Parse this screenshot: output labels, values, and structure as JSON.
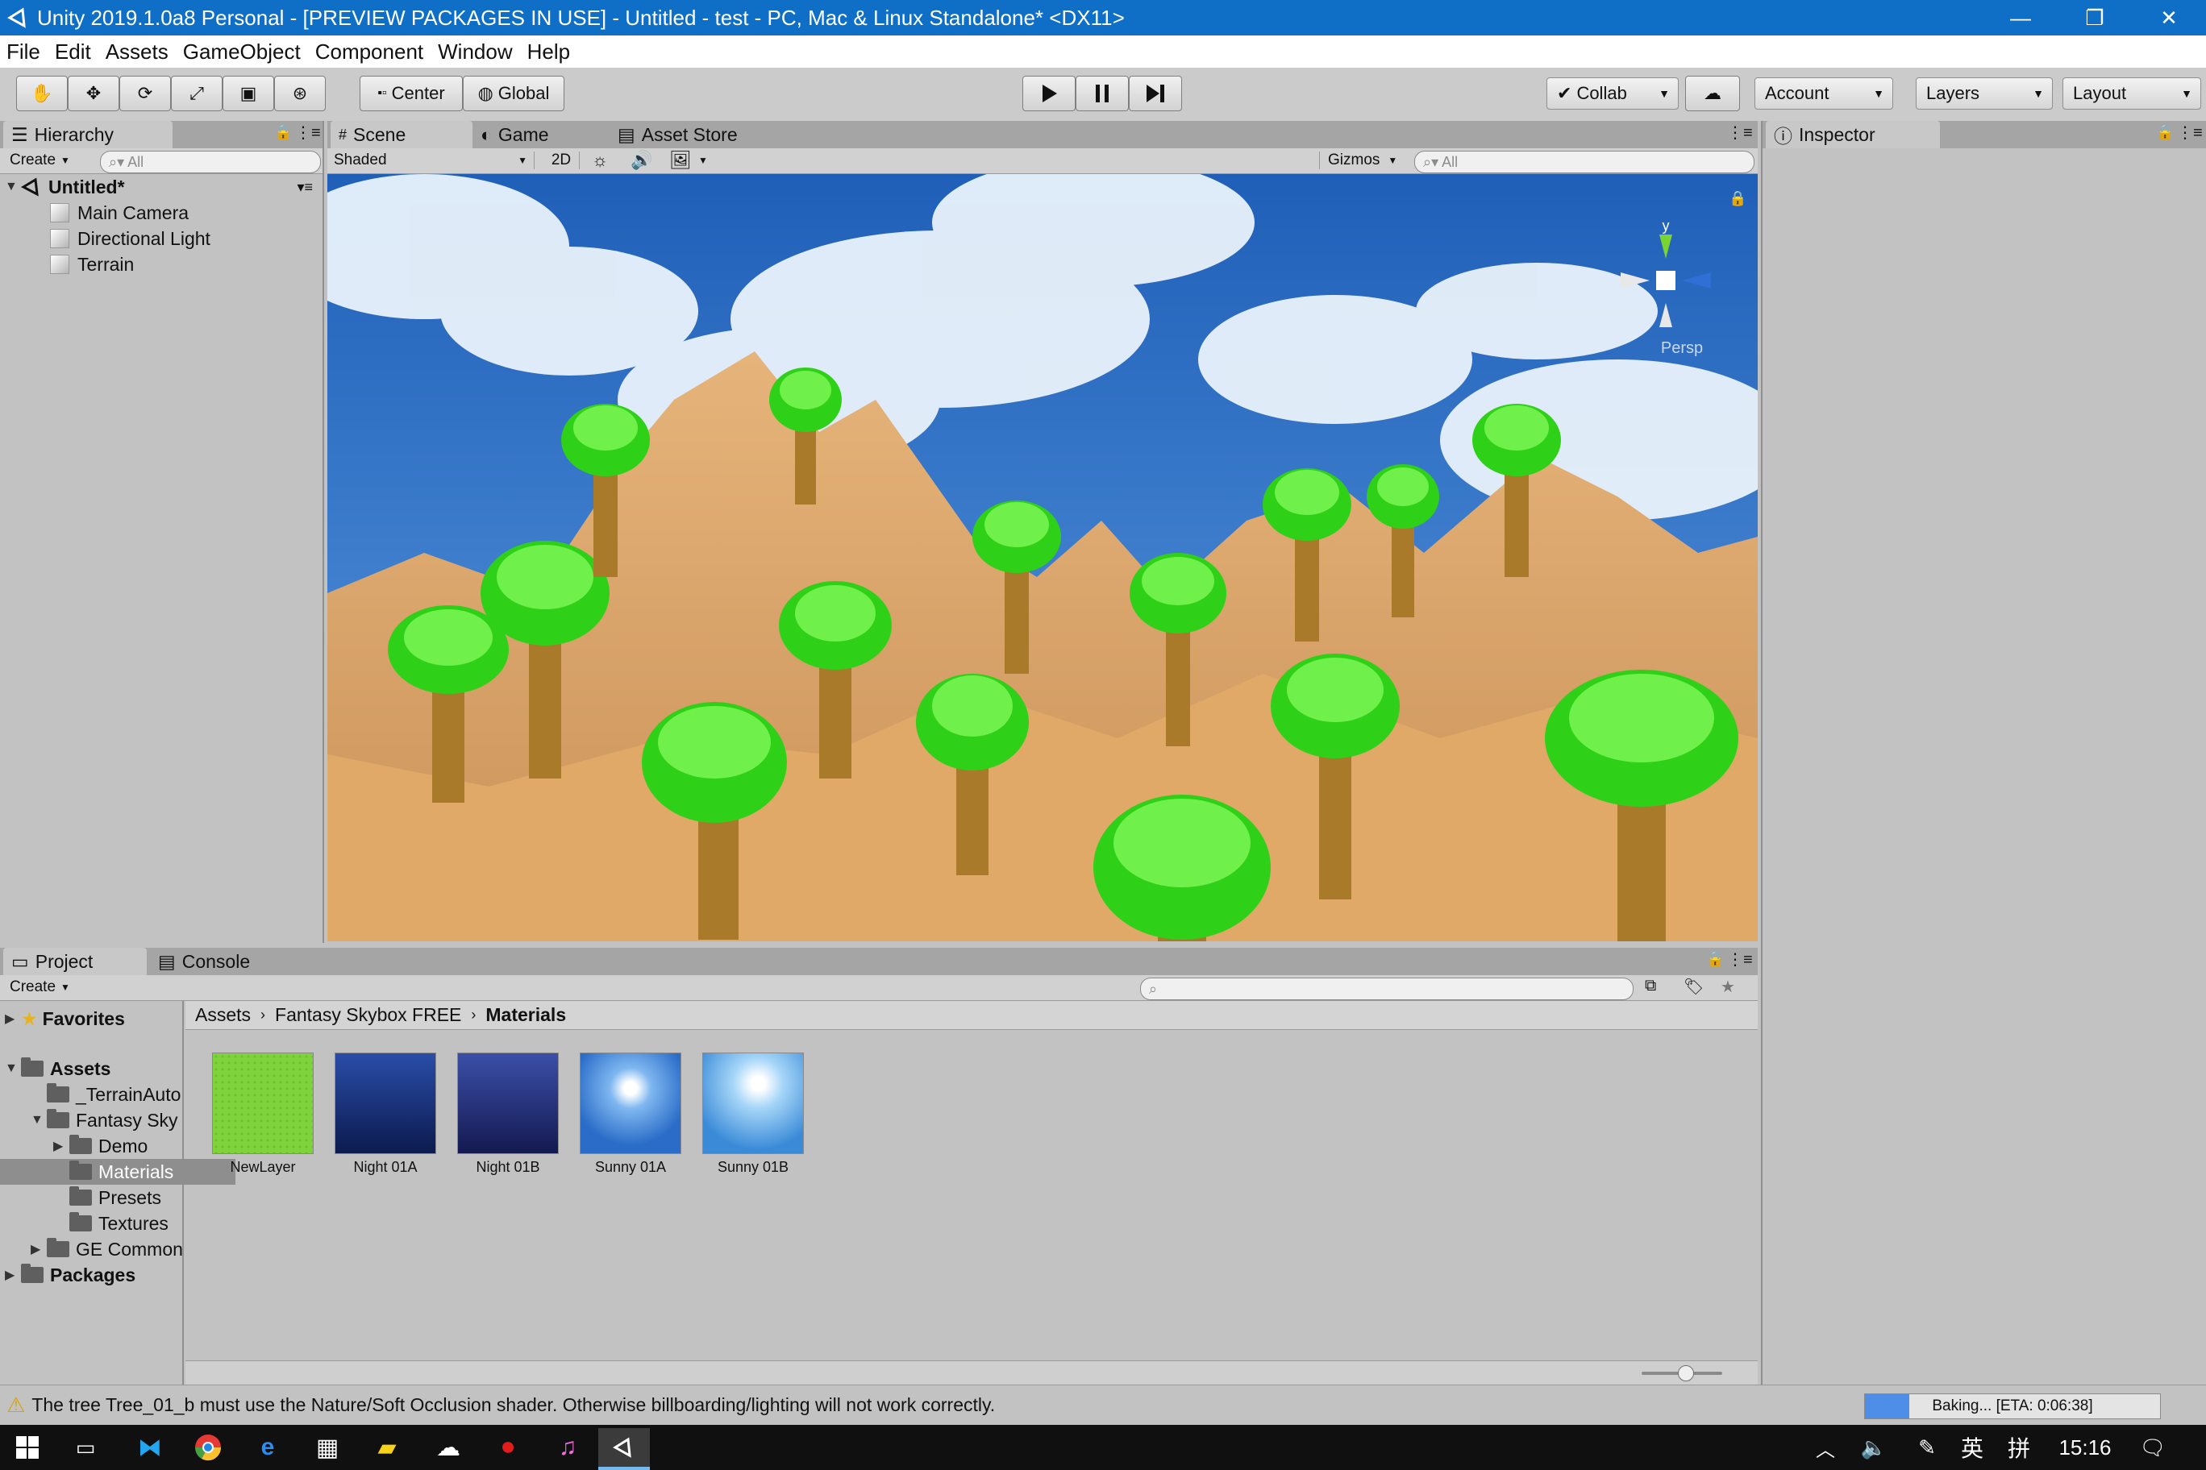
{
  "window": {
    "title": "Unity 2019.1.0a8 Personal - [PREVIEW PACKAGES IN USE] - Untitled - test - PC, Mac & Linux Standalone* <DX11>",
    "minimize": "—",
    "restore": "❐",
    "close": "✕"
  },
  "menu": [
    "File",
    "Edit",
    "Assets",
    "GameObject",
    "Component",
    "Window",
    "Help"
  ],
  "toolbar": {
    "center_label": "Center",
    "global_label": "Global",
    "collab_label": "Collab",
    "account_label": "Account",
    "layers_label": "Layers",
    "layout_label": "Layout",
    "play_icon": "play-icon",
    "pause_icon": "pause-icon",
    "step_icon": "step-icon"
  },
  "hierarchy": {
    "tab_label": "Hierarchy",
    "create_label": "Create",
    "search_placeholder": "All",
    "scene_name": "Untitled*",
    "items": [
      "Main Camera",
      "Directional Light",
      "Terrain"
    ]
  },
  "scene": {
    "tabs": [
      "Scene",
      "Game",
      "Asset Store"
    ],
    "shading_mode": "Shaded",
    "mode_2d": "2D",
    "gizmos_label": "Gizmos",
    "search_placeholder": "All",
    "gizmo_y": "y",
    "gizmo_persp": "Persp",
    "sky_color": "#2e6fc2",
    "terrain_color": "#e3b37a",
    "tree_color": "#39d61c"
  },
  "inspector": {
    "tab_label": "Inspector"
  },
  "project": {
    "tabs": [
      "Project",
      "Console"
    ],
    "create_label": "Create",
    "favorites_label": "Favorites",
    "assets_label": "Assets",
    "tree": [
      {
        "label": "_TerrainAuto",
        "depth": 1,
        "expand": ""
      },
      {
        "label": "Fantasy Sky",
        "depth": 1,
        "expand": "▼"
      },
      {
        "label": "Demo",
        "depth": 2,
        "expand": "▶"
      },
      {
        "label": "Materials",
        "depth": 2,
        "expand": "",
        "selected": true
      },
      {
        "label": "Presets",
        "depth": 2,
        "expand": ""
      },
      {
        "label": "Textures",
        "depth": 2,
        "expand": ""
      },
      {
        "label": "GE Common",
        "depth": 1,
        "expand": "▶"
      }
    ],
    "packages_label": "Packages",
    "breadcrumb": [
      "Assets",
      "Fantasy Skybox FREE",
      "Materials"
    ],
    "assets": [
      {
        "name": "NewLayer",
        "style": "grass"
      },
      {
        "name": "Night 01A",
        "style": "night"
      },
      {
        "name": "Night 01B",
        "style": "night2"
      },
      {
        "name": "Sunny 01A",
        "style": "sunny"
      },
      {
        "name": "Sunny 01B",
        "style": "sunny2"
      }
    ],
    "zoom_level": 0.55
  },
  "status": {
    "message": "The tree Tree_01_b must use the Nature/Soft Occlusion shader. Otherwise billboarding/lighting will not work correctly.",
    "baking_text": "Baking... [ETA: 0:06:38]",
    "baking_progress": 0.15
  },
  "taskbar": {
    "time": "15:16",
    "ime_lang": "英",
    "ime_mode": "拼"
  }
}
